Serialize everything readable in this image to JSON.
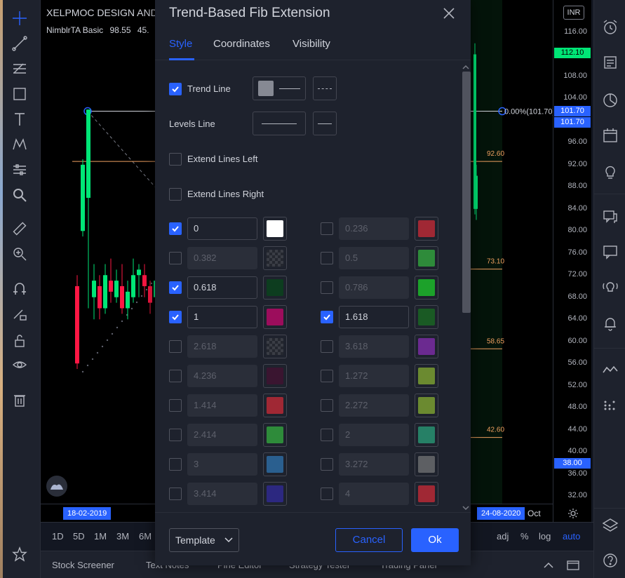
{
  "chart": {
    "symbol_title": "XELPMOC DESIGN AND",
    "indicator_name": "NimblrTA Basic",
    "indicator_val1": "98.55",
    "indicator_val2": "45.",
    "fib_label": "0.00%(101.70)",
    "fib_levels_right": [
      "92.60",
      "73.10",
      "58.65",
      "42.60"
    ],
    "candles": [
      {
        "o": 70,
        "c": 56,
        "h": 72,
        "l": 55
      },
      {
        "o": 80,
        "c": 92,
        "h": 93,
        "l": 79
      },
      {
        "o": 86,
        "c": 102,
        "h": 102,
        "l": 66
      },
      {
        "o": 68,
        "c": 71,
        "h": 74,
        "l": 64
      },
      {
        "o": 70,
        "c": 66,
        "h": 72,
        "l": 64
      },
      {
        "o": 66,
        "c": 72,
        "h": 74,
        "l": 65
      },
      {
        "o": 71,
        "c": 69,
        "h": 75,
        "l": 67
      },
      {
        "o": 68,
        "c": 71,
        "h": 73,
        "l": 67
      },
      {
        "o": 70,
        "c": 66,
        "h": 74,
        "l": 65
      },
      {
        "o": 66,
        "c": 69,
        "h": 71,
        "l": 64
      },
      {
        "o": 68,
        "c": 72,
        "h": 75,
        "l": 67
      },
      {
        "o": 72,
        "c": 73,
        "h": 74,
        "l": 68
      },
      {
        "o": 72,
        "c": 70,
        "h": 74,
        "l": 68
      },
      {
        "o": 70,
        "c": 67,
        "h": 71,
        "l": 65
      },
      {
        "o": 68,
        "c": 71,
        "h": 72,
        "l": 66
      }
    ],
    "right_candles": [
      {
        "o": 84,
        "c": 112,
        "h": 114,
        "l": 83
      },
      {
        "o": 84,
        "c": 90,
        "h": 92,
        "l": 82
      }
    ]
  },
  "price_scale": {
    "currency": "INR",
    "ticks": [
      "116.00",
      "108.00",
      "104.00",
      "96.00",
      "92.00",
      "88.00",
      "84.00",
      "80.00",
      "76.00",
      "72.00",
      "68.00",
      "64.00",
      "60.00",
      "56.00",
      "52.00",
      "48.00",
      "44.00",
      "40.00",
      "36.00",
      "32.00"
    ],
    "tag_current": "112.10",
    "tag_fib1": "101.70",
    "tag_fib2": "101.70",
    "tag_low": "38.00"
  },
  "time_scale": {
    "start_date": "18-02-2019",
    "end_date": "24-08-2020",
    "month": "Oct"
  },
  "bottom_bar": {
    "timeframes": [
      "1D",
      "5D",
      "1M",
      "3M",
      "6M"
    ],
    "right_opts": [
      "adj",
      "%",
      "log",
      "auto"
    ]
  },
  "panel_tabs": [
    "Stock Screener",
    "Text Notes",
    "Pine Editor",
    "Strategy Tester",
    "Trading Panel"
  ],
  "dialog": {
    "title": "Trend-Based Fib Extension",
    "tabs": [
      "Style",
      "Coordinates",
      "Visibility"
    ],
    "trend_line_label": "Trend Line",
    "levels_line_label": "Levels Line",
    "extend_left_label": "Extend Lines Left",
    "extend_right_label": "Extend Lines Right",
    "levels_left": [
      {
        "value": "0",
        "checked": true,
        "color": "#ffffff"
      },
      {
        "value": "0.382",
        "checked": false,
        "color": "checker"
      },
      {
        "value": "0.618",
        "checked": true,
        "color": "#0d3d1f"
      },
      {
        "value": "1",
        "checked": true,
        "color": "#9c0d5c"
      },
      {
        "value": "2.618",
        "checked": false,
        "color": "checker"
      },
      {
        "value": "4.236",
        "checked": false,
        "color": "#3a1530"
      },
      {
        "value": "1.414",
        "checked": false,
        "color": "#a02834"
      },
      {
        "value": "2.414",
        "checked": false,
        "color": "#2e8b3a"
      },
      {
        "value": "3",
        "checked": false,
        "color": "#2a5f8f"
      },
      {
        "value": "3.414",
        "checked": false,
        "color": "#2c2880"
      }
    ],
    "levels_right": [
      {
        "value": "0.236",
        "checked": false,
        "color": "#a02834"
      },
      {
        "value": "0.5",
        "checked": false,
        "color": "#2e8b3a"
      },
      {
        "value": "0.786",
        "checked": false,
        "color": "#1ca12a"
      },
      {
        "value": "1.618",
        "checked": true,
        "color": "#1a5a24"
      },
      {
        "value": "3.618",
        "checked": false,
        "color": "#6b2a90"
      },
      {
        "value": "1.272",
        "checked": false,
        "color": "#6b8a30"
      },
      {
        "value": "2.272",
        "checked": false,
        "color": "#6b8a30"
      },
      {
        "value": "2",
        "checked": false,
        "color": "#268066"
      },
      {
        "value": "3.272",
        "checked": false,
        "color": "#5d5f63"
      },
      {
        "value": "4",
        "checked": false,
        "color": "#a02834"
      }
    ],
    "template_label": "Template",
    "cancel_label": "Cancel",
    "ok_label": "Ok"
  }
}
